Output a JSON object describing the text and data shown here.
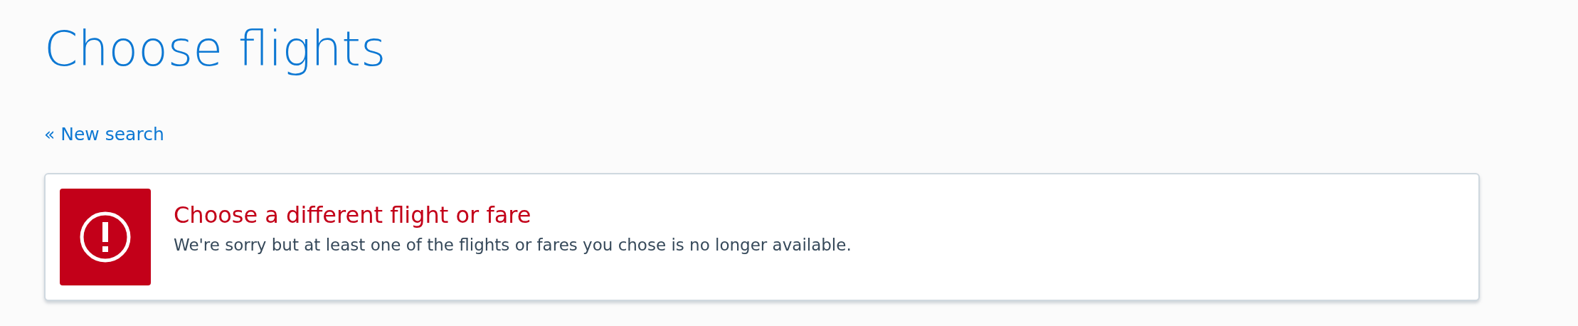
{
  "page_title": "Choose flights",
  "back_link": "« New search",
  "alert": {
    "kind": "error",
    "title": "Choose a different flight or fare",
    "message": "We're sorry but at least one of the flights or fares you chose is no longer available."
  }
}
